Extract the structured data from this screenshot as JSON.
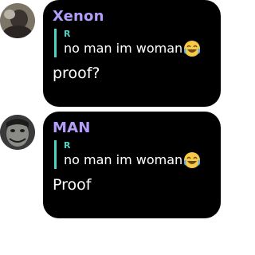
{
  "colors": {
    "bubble_bg": "#000000",
    "author_name": "#b39dfb",
    "reply_author": "#4fd1c5",
    "reply_bar": "#4fd1c5",
    "text": "#ffffff"
  },
  "messages": [
    {
      "author": "Xenon",
      "reply": {
        "author": "R",
        "text": "no man im woman",
        "emoji": "face-with-tears-of-joy"
      },
      "text": "proof?",
      "avatar": "avatar-xenon"
    },
    {
      "author": "MAN",
      "reply": {
        "author": "R",
        "text": "no man im woman",
        "emoji": "face-with-tears-of-joy"
      },
      "text": "Proof",
      "avatar": "avatar-man"
    }
  ]
}
